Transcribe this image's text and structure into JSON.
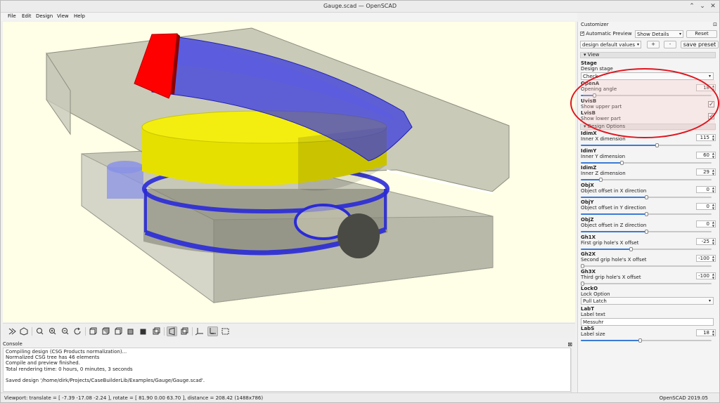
{
  "window": {
    "title": "Gauge.scad — OpenSCAD",
    "controls": [
      "⌃",
      "⌄",
      "✕"
    ]
  },
  "menubar": {
    "items": [
      "File",
      "Edit",
      "Design",
      "View",
      "Help"
    ]
  },
  "toolbar": {
    "buttons": [
      "render-fast-icon",
      "render-full-icon",
      "zoom-all-icon",
      "zoom-in-icon",
      "zoom-out-icon",
      "reset-view-icon",
      "view-right-icon",
      "view-top-icon",
      "view-bottom-icon",
      "view-left-icon",
      "view-front-icon",
      "view-back-icon",
      "perspective-icon",
      "orthogonal-icon",
      "axes-icon",
      "scale-markers-icon",
      "edges-icon"
    ]
  },
  "console": {
    "header": "Console",
    "lines": [
      "Compiling design (CSG Products normalization)...",
      "Normalized CSG tree has 46 elements",
      "Compile and preview finished.",
      "Total rendering time: 0 hours, 0 minutes, 3 seconds",
      "",
      "Saved design '/home/dirk/Projects/CaseBuilderLib/Examples/Gauge/Gauge.scad'."
    ]
  },
  "status": {
    "viewport": "Viewport: translate = [ -7.39 -17.08 -2.24 ], rotate = [ 81.90 0.00 63.70 ], distance = 208.42 (1488x786)",
    "version": "OpenSCAD 2019.05"
  },
  "customizer": {
    "title": "Customizer",
    "dock_icon": "⊡",
    "auto_preview_label": "Automatic Preview",
    "auto_preview_checked": true,
    "show_details": "Show Details",
    "reset": "Reset",
    "preset": "design default values",
    "plus": "+",
    "minus": "-",
    "save_preset": "save preset",
    "view_section": "View",
    "design_section": "Design Options",
    "stage": {
      "name": "Stage",
      "desc": "Design stage",
      "value": "Check"
    },
    "openA": {
      "name": "OpenA",
      "desc": "Opening angle",
      "value": "18",
      "level": 0.1
    },
    "uvisB": {
      "name": "UvisB",
      "desc": "Show upper part",
      "checked": "✓"
    },
    "lvisB": {
      "name": "LvisB",
      "desc": "Show lower part",
      "checked": "✓"
    },
    "params": [
      {
        "name": "IdimX",
        "desc": "Inner X dimension",
        "value": "115",
        "level": 0.58
      },
      {
        "name": "IdimY",
        "desc": "Inner Y dimension",
        "value": "60",
        "level": 0.31
      },
      {
        "name": "IdimZ",
        "desc": "Inner Z dimension",
        "value": "29",
        "level": 0.15
      },
      {
        "name": "ObjX",
        "desc": "Object offset in X direction",
        "value": "0",
        "level": 0.5
      },
      {
        "name": "ObjY",
        "desc": "Object offset in Y direction",
        "value": "0",
        "level": 0.5
      },
      {
        "name": "ObjZ",
        "desc": "Object offset in Z direction",
        "value": "0",
        "level": 0.5
      },
      {
        "name": "Gh1X",
        "desc": "First grip hole's X offset",
        "value": "-25",
        "level": 0.38
      },
      {
        "name": "Gh2X",
        "desc": "Second grip hole's X offset",
        "value": "-100",
        "level": 0.0
      },
      {
        "name": "Gh3X",
        "desc": "Third grip hole's X offset",
        "value": "-100",
        "level": 0.0
      }
    ],
    "lockO": {
      "name": "LockO",
      "desc": "Lock Option",
      "value": "Pull Latch"
    },
    "labT": {
      "name": "LabT",
      "desc": "Label text",
      "value": "Messuhr"
    },
    "labS": {
      "name": "LabS",
      "desc": "Label size",
      "value": "18",
      "level": 0.45
    }
  },
  "colors": {
    "accent": "#3a7bd5",
    "highlight": "#e0141e",
    "viewport_bg": "#ffffe7"
  }
}
